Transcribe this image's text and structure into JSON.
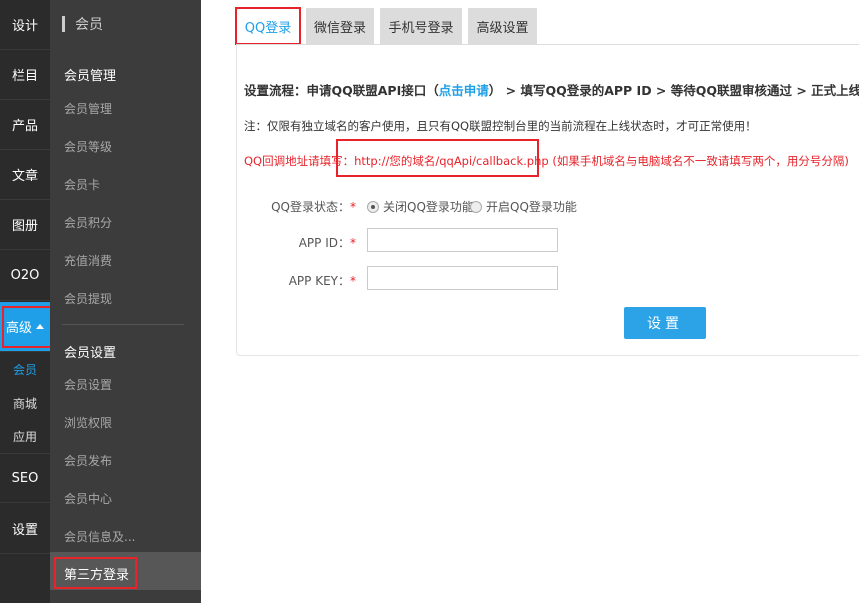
{
  "rail": {
    "items": [
      {
        "label": "设计"
      },
      {
        "label": "栏目"
      },
      {
        "label": "产品"
      },
      {
        "label": "文章"
      },
      {
        "label": "图册"
      },
      {
        "label": "O2O"
      },
      {
        "label": "高级"
      }
    ],
    "subitems": [
      {
        "label": "会员"
      },
      {
        "label": "商城"
      },
      {
        "label": "应用"
      }
    ],
    "bottom_items": [
      {
        "label": "SEO"
      },
      {
        "label": "设置"
      }
    ]
  },
  "subnav": {
    "title": "会员",
    "groups": [
      {
        "heading": "会员管理",
        "links": [
          "会员管理",
          "会员等级",
          "会员卡",
          "会员积分",
          "充值消费",
          "会员提现"
        ]
      },
      {
        "heading": "会员设置",
        "links": [
          "会员设置",
          "浏览权限",
          "会员发布",
          "会员中心",
          "会员信息及..."
        ]
      }
    ],
    "active_item": "第三方登录"
  },
  "tabs": [
    "QQ登录",
    "微信登录",
    "手机号登录",
    "高级设置"
  ],
  "content": {
    "flow_prefix": "设置流程：申请QQ联盟API接口（",
    "flow_link": "点击申请",
    "flow_suffix": "）  >  填写QQ登录的APP ID  >  等待QQ联盟审核通过  >  正式上线",
    "note": "注：仅限有独立域名的客户使用，且只有QQ联盟控制台里的当前流程在上线状态时，才可正常使用！",
    "callback_label": "QQ回调地址请填写：",
    "callback_url": "http://您的域名/qqApi/callback.php",
    "callback_hint": "(如果手机域名与电脑域名不一致请填写两个，用分号分隔)"
  },
  "form": {
    "status_label": "QQ登录状态：",
    "options": [
      "关闭QQ登录功能",
      "开启QQ登录功能"
    ],
    "selected_option": "关闭QQ登录功能",
    "appid_label": "APP ID：",
    "appid_value": "",
    "appkey_label": "APP KEY：",
    "appkey_value": "",
    "required_mark": "*",
    "submit_label": "设置"
  },
  "colors": {
    "accent": "#1e9fe8",
    "highlight": "#e8232a",
    "rail_bg": "#2b2b2b",
    "subnav_bg": "#3c3c3c"
  }
}
